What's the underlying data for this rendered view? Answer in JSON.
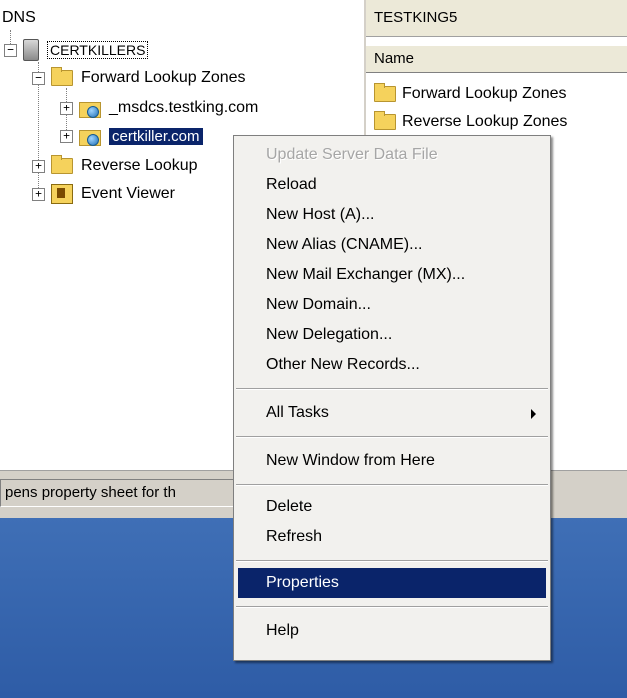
{
  "tree": {
    "root": "DNS",
    "server": "CERTKILLERS",
    "forward_zones": "Forward Lookup Zones",
    "msdcs_zone": "_msdcs.testking.com",
    "certkiller_zone": "certkiller.com",
    "reverse_zones": "Reverse Lookup",
    "event_viewer": "Event Viewer",
    "expanded_glyph": "−",
    "collapsed_glyph": "+"
  },
  "right_pane": {
    "title": "TESTKING5",
    "column": "Name",
    "items": [
      "Forward Lookup Zones",
      "Reverse Lookup Zones"
    ]
  },
  "status_bar": {
    "text": "pens property sheet for th"
  },
  "context_menu": {
    "items": [
      "Update Server Data File",
      "Reload",
      "New Host (A)...",
      "New Alias (CNAME)...",
      "New Mail Exchanger (MX)...",
      "New Domain...",
      "New Delegation...",
      "Other New Records...",
      "All Tasks",
      "New Window from Here",
      "Delete",
      "Refresh",
      "Properties",
      "Help"
    ],
    "highlighted": "Properties",
    "disabled": "Update Server Data File"
  },
  "colors": {
    "selection": "#0a246a",
    "menu_background": "#f2f1ee",
    "desktop": "#3f6fb6"
  }
}
